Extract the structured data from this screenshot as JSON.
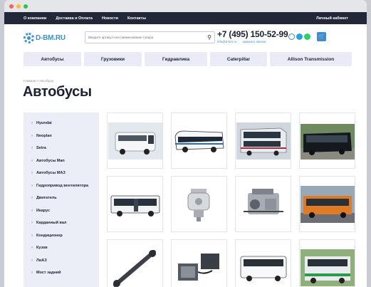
{
  "topbar": {
    "nav": [
      "О компании",
      "Доставка и Оплата",
      "Новости",
      "Контакты"
    ],
    "account": "Личный кабинет"
  },
  "header": {
    "logo": "D-BM.RU",
    "search_placeholder": "Введите артикул или наименование товара",
    "phone": "+7 (495) 150-52-99",
    "email": "info@d-bm.ru",
    "callback": "заказать звонок"
  },
  "categories": [
    "Автобусы",
    "Грузовики",
    "Гидравлика",
    "Caterpillar",
    "Allison Transmission"
  ],
  "breadcrumb": "Главная > Автобусы",
  "page_title": "Автобусы",
  "sidebar": [
    "Hyundai",
    "Neoplan",
    "Setra",
    "Автобусы Man",
    "Автобусы МАЗ",
    "Гидропривод вентилятора",
    "Двигатель",
    "Икарус",
    "Карданный вал",
    "Кондиционер",
    "Кузов",
    "ЛиАЗ",
    "Мост задний"
  ],
  "products": [
    {
      "icon": "minibus-image"
    },
    {
      "icon": "coach-bus-image"
    },
    {
      "icon": "double-decker-bus-image"
    },
    {
      "icon": "black-coach-image"
    },
    {
      "icon": "city-bus-image"
    },
    {
      "icon": "hydraulic-pump-image"
    },
    {
      "icon": "engine-image"
    },
    {
      "icon": "orange-bus-image"
    },
    {
      "icon": "cardan-shaft-image"
    },
    {
      "icon": "air-conditioner-image"
    },
    {
      "icon": "white-bus-image"
    },
    {
      "icon": "liaz-bus-image"
    }
  ],
  "colors": {
    "accent": "#3a8fd4",
    "dark": "#232838",
    "light": "#e9ecf6"
  }
}
